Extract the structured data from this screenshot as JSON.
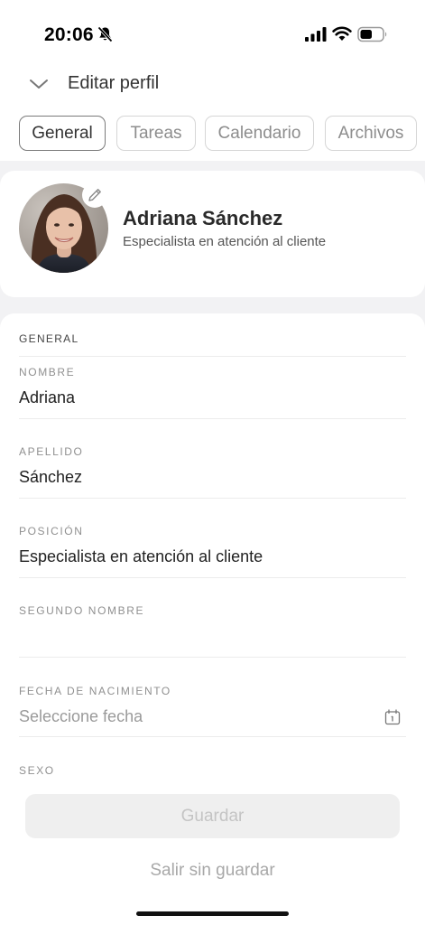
{
  "status_bar": {
    "time": "20:06",
    "icons": [
      "bell-slash-icon",
      "signal-icon",
      "wifi-icon",
      "battery-icon"
    ]
  },
  "header": {
    "title": "Editar perfil",
    "back_icon": "chevron-down-icon"
  },
  "tabs": [
    {
      "label": "General",
      "active": true
    },
    {
      "label": "Tareas",
      "active": false
    },
    {
      "label": "Calendario",
      "active": false
    },
    {
      "label": "Archivos",
      "active": false
    }
  ],
  "profile": {
    "name": "Adriana Sánchez",
    "position": "Especialista en atención al cliente",
    "edit_icon": "pencil-icon"
  },
  "form": {
    "section_title": "GENERAL",
    "fields": [
      {
        "label": "NOMBRE",
        "value": "Adriana",
        "placeholder": ""
      },
      {
        "label": "APELLIDO",
        "value": "Sánchez",
        "placeholder": ""
      },
      {
        "label": "POSICIÓN",
        "value": "Especialista en atención al cliente",
        "placeholder": ""
      },
      {
        "label": "SEGUNDO NOMBRE",
        "value": "",
        "placeholder": ""
      },
      {
        "label": "FECHA DE NACIMIENTO",
        "value": "",
        "placeholder": "Seleccione fecha",
        "icon": "calendar-icon"
      },
      {
        "label": "SEXO",
        "value": "",
        "placeholder": ""
      }
    ]
  },
  "actions": {
    "save_label": "Guardar",
    "exit_label": "Salir sin guardar"
  },
  "colors": {
    "background": "#f2f2f4",
    "card": "#ffffff",
    "active_tab_border": "#7a7a7a",
    "disabled_button": "#efefef"
  }
}
